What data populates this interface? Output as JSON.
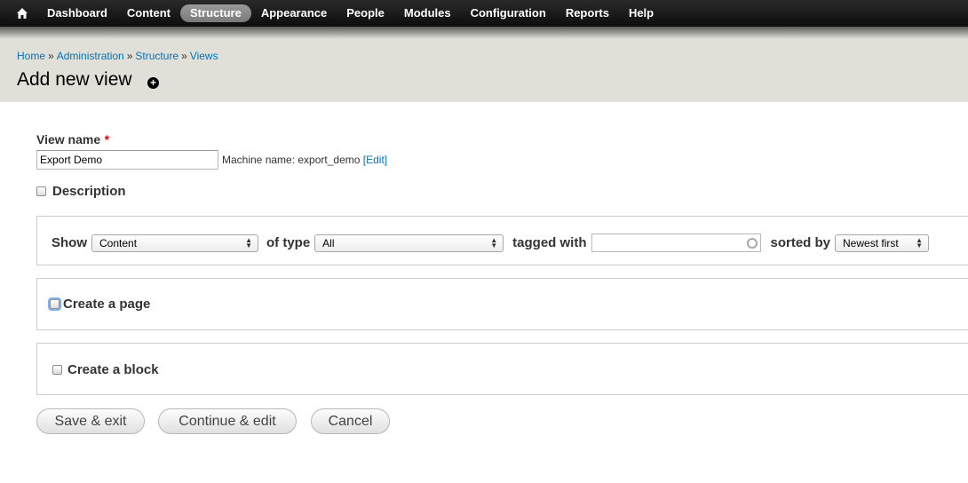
{
  "toolbar": {
    "home_icon": "home-icon",
    "items": [
      "Dashboard",
      "Content",
      "Structure",
      "Appearance",
      "People",
      "Modules",
      "Configuration",
      "Reports",
      "Help"
    ],
    "active_item": "Structure"
  },
  "breadcrumb": {
    "items": [
      "Home",
      "Administration",
      "Structure",
      "Views"
    ],
    "separator": "»"
  },
  "page": {
    "title": "Add new view",
    "shortcut_icon": "add-shortcut-icon"
  },
  "form": {
    "view_name_label": "View name",
    "required_marker": "*",
    "view_name_value": "Export Demo",
    "machine_name_prefix": "Machine name: export_demo",
    "machine_name_edit": "[Edit]",
    "description_label": "Description",
    "description_checked": false,
    "show_label": "Show",
    "show_value": "Content",
    "of_type_label": "of type",
    "of_type_value": "All",
    "tagged_with_label": "tagged with",
    "tagged_with_value": "",
    "sorted_by_label": "sorted by",
    "sorted_by_value": "Newest first",
    "create_page_label": "Create a page",
    "create_page_checked": false,
    "create_block_label": "Create a block",
    "create_block_checked": false
  },
  "buttons": {
    "save_exit": "Save & exit",
    "continue_edit": "Continue & edit",
    "cancel": "Cancel"
  },
  "colors": {
    "link": "#0074bd",
    "required": "#dd0000",
    "header_bg": "#e0e0d8",
    "toolbar_bg": "#0d0d0d"
  }
}
